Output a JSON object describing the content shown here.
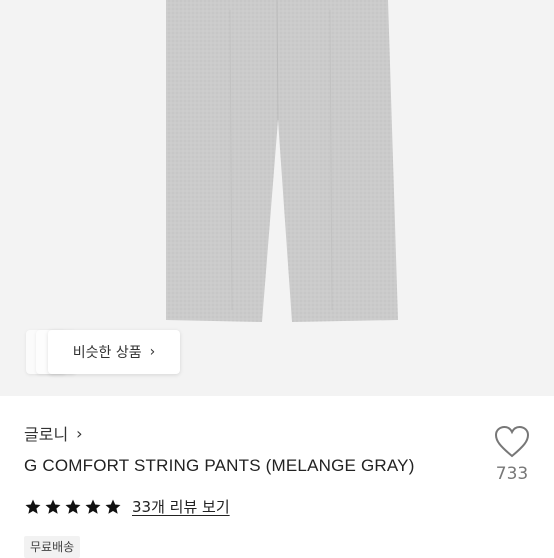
{
  "similar_button": {
    "label": "비슷한 상품",
    "chevron": "chevron-right-icon"
  },
  "product": {
    "brand": "글로니",
    "title": "G COMFORT STRING PANTS (MELANGE GRAY)",
    "likes": "733",
    "rating_stars": 5,
    "review_link": "33개 리뷰 보기",
    "shipping_tag": "무료배송"
  },
  "colors": {
    "background": "#ffffff",
    "hero_bg": "#f3f3f3",
    "pants_gray": "#c9c9c9",
    "star": "#111111",
    "heart_stroke": "#777777"
  }
}
